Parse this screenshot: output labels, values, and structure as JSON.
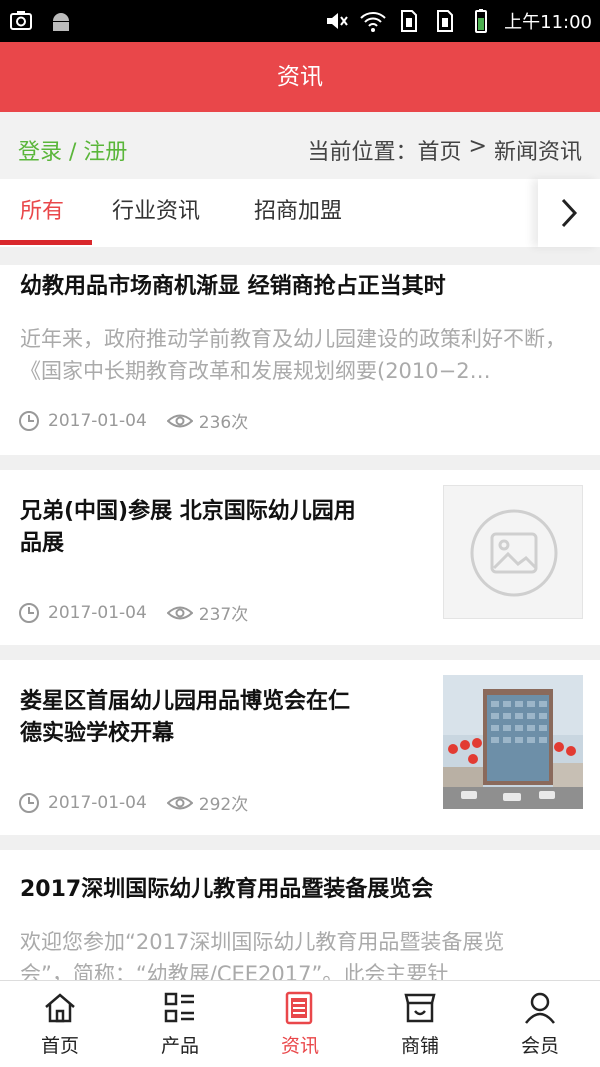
{
  "status_bar": {
    "time": "上午11:00",
    "icons": [
      "screenshot-icon",
      "android-icon",
      "mute-icon",
      "wifi-icon",
      "sim1-icon",
      "sim2-icon",
      "battery-icon"
    ]
  },
  "header": {
    "title": "资讯"
  },
  "breadcrumb": {
    "login_link": "登录 / 注册",
    "location_prefix": "当前位置：",
    "home": "首页",
    "separator": " > ",
    "current": "新闻资讯"
  },
  "tabs": [
    {
      "label": "所有",
      "active": true
    },
    {
      "label": "行业资讯",
      "active": false
    },
    {
      "label": "招商加盟",
      "active": false
    }
  ],
  "articles": [
    {
      "title": "幼教用品市场商机渐显 经销商抢占正当其时",
      "summary": "近年来，政府推动学前教育及幼儿园建设的政策利好不断，《国家中长期教育改革和发展规划纲要(2010−2…",
      "date": "2017-01-04",
      "views": "236次"
    },
    {
      "title_line1": "兄弟(中国)参展 北京国际幼儿园用",
      "title_line2": "品展",
      "date": "2017-01-04",
      "views": "237次",
      "thumbnail": "placeholder-image-icon"
    },
    {
      "title_line1": "娄星区首届幼儿园用品博览会在仁",
      "title_line2": "德实验学校开幕",
      "date": "2017-01-04",
      "views": "292次",
      "thumbnail": "building-photo"
    },
    {
      "title": "2017深圳国际幼儿教育用品暨装备展览会",
      "summary_line1": "欢迎您参加“2017深圳国际幼儿教育用品暨装备展览",
      "summary_line2": "会”，简称：“幼教展/CEE2017”。此会主要针"
    }
  ],
  "bottom_nav": [
    {
      "label": "首页",
      "icon": "home-icon",
      "active": false
    },
    {
      "label": "产品",
      "icon": "list-icon",
      "active": false
    },
    {
      "label": "资讯",
      "icon": "news-icon",
      "active": true
    },
    {
      "label": "商铺",
      "icon": "shop-icon",
      "active": false
    },
    {
      "label": "会员",
      "icon": "user-icon",
      "active": false
    }
  ],
  "colors": {
    "accent": "#e9474a",
    "login_green": "#5ab63a",
    "muted_text": "#aaaaaa"
  }
}
